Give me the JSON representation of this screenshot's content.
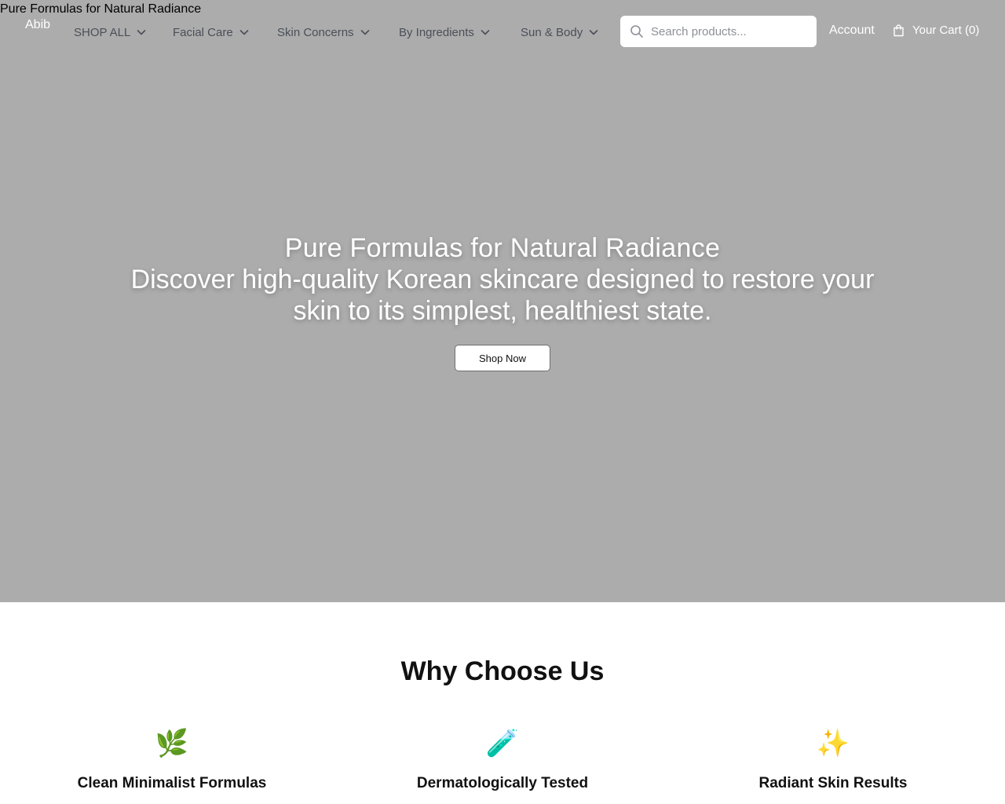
{
  "document_title": "Pure Formulas for Natural Radiance",
  "header": {
    "logo": "Abib",
    "nav": [
      {
        "label": "SHOP ALL"
      },
      {
        "label": "Facial Care"
      },
      {
        "label": "Skin Concerns"
      },
      {
        "label": "By Ingredients"
      },
      {
        "label": "Sun & Body"
      }
    ],
    "search": {
      "placeholder": "Search products...",
      "value": ""
    },
    "account_label": "Account",
    "cart_label": "Your Cart (0)"
  },
  "hero": {
    "title": "Pure Formulas for Natural Radiance",
    "subtitle": "Discover high-quality Korean skincare designed to restore your skin to its simplest, healthiest state.",
    "cta_label": "Shop Now"
  },
  "features": {
    "title": "Why Choose Us",
    "items": [
      {
        "icon": "🌿",
        "icon_name": "herb-icon",
        "label": "Clean Minimalist Formulas"
      },
      {
        "icon": "🧪",
        "icon_name": "test-tube-icon",
        "label": "Dermatologically Tested"
      },
      {
        "icon": "✨",
        "icon_name": "sparkles-icon",
        "label": "Radiant Skin Results"
      }
    ]
  },
  "colors": {
    "hero_background": "#acacac",
    "nav_text": "#4a4f57",
    "header_text": "#ffffff"
  }
}
